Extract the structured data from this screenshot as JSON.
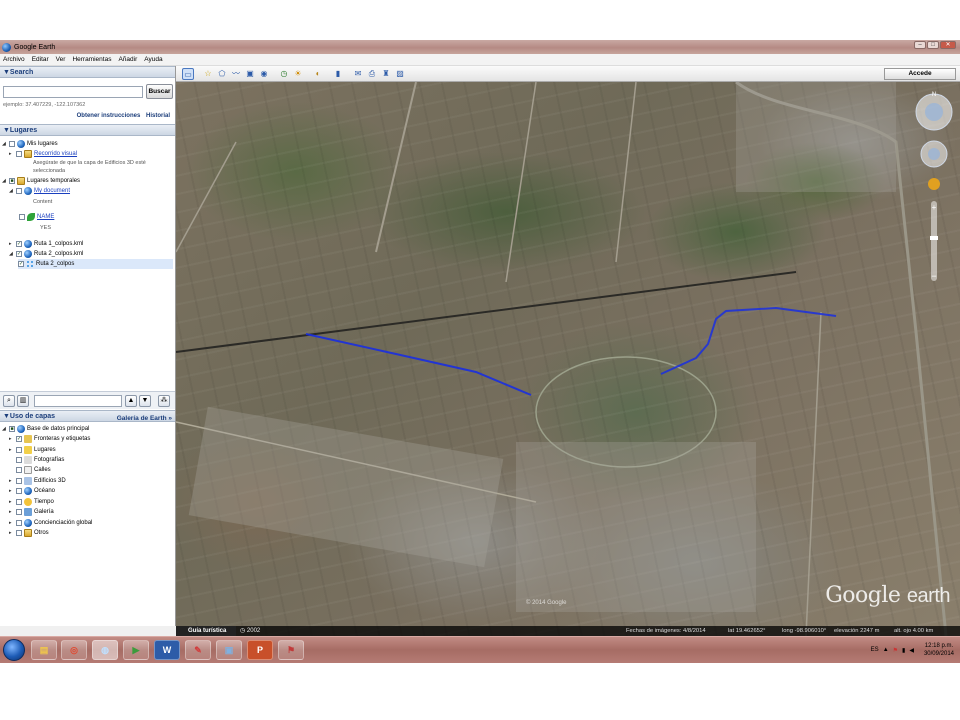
{
  "window": {
    "title": "Google Earth"
  },
  "menu": [
    "Archivo",
    "Editar",
    "Ver",
    "Herramientas",
    "Añadir",
    "Ayuda"
  ],
  "search": {
    "header": "▼Search",
    "button": "Buscar",
    "hint": "ejemplo: 37.407229, -122.107362",
    "link_instructions": "Obtener instrucciones",
    "link_history": "Historial"
  },
  "places": {
    "header": "▼Lugares",
    "items": [
      {
        "label": "Mis lugares",
        "link": false
      },
      {
        "label": "Recorrido visual",
        "link": true
      },
      {
        "label": "Asegúrate de que la capa de Edificios 3D esté",
        "sub": true
      },
      {
        "label": "seleccionada",
        "sub": true
      },
      {
        "label": "Lugares temporales",
        "link": false
      },
      {
        "label": "My document",
        "link": true
      },
      {
        "label": "Content",
        "sub": true
      },
      {
        "label": "NAME",
        "link": true
      },
      {
        "label": "YES",
        "sub": true
      },
      {
        "label": "Ruta 1_colpos.kml",
        "link": false
      },
      {
        "label": "Ruta 2_colpos.kml",
        "link": false
      },
      {
        "label": "Ruta 2_colpos",
        "link": false
      }
    ]
  },
  "layers": {
    "header": "▼Uso de capas",
    "gallery": "Galería de Earth »",
    "items": [
      "Base de datos principal",
      "Fronteras y etiquetas",
      "Lugares",
      "Fotografías",
      "Calles",
      "Edificios 3D",
      "Océano",
      "Tiempo",
      "Galería",
      "Concienciación global",
      "Otros"
    ]
  },
  "toolbar": {
    "signin": "Accede"
  },
  "map": {
    "watermark_main": "Google",
    "watermark_suffix": "earth",
    "copyright": "© 2014 Google"
  },
  "statusbar": {
    "tour": "Guía turística",
    "year": "2002",
    "imagery_date": "Fechas de imágenes: 4/8/2014",
    "lat": "lat  19.462652°",
    "long": "long  -98.906010°",
    "elevation": "elevación  2247 m",
    "eye_alt": "alt. ojo  4.00 km"
  },
  "taskbar": {
    "apps": [
      "start",
      "explorer",
      "chrome",
      "google-earth",
      "media",
      "word",
      "paint",
      "photos",
      "powerpoint",
      "flag"
    ],
    "lang": "ES",
    "time": "12:18 p.m.",
    "date": "30/09/2014"
  },
  "colors": {
    "route": "#1a2fe0",
    "link": "#1a3fbf",
    "panel_header": "#1b3d7a"
  }
}
